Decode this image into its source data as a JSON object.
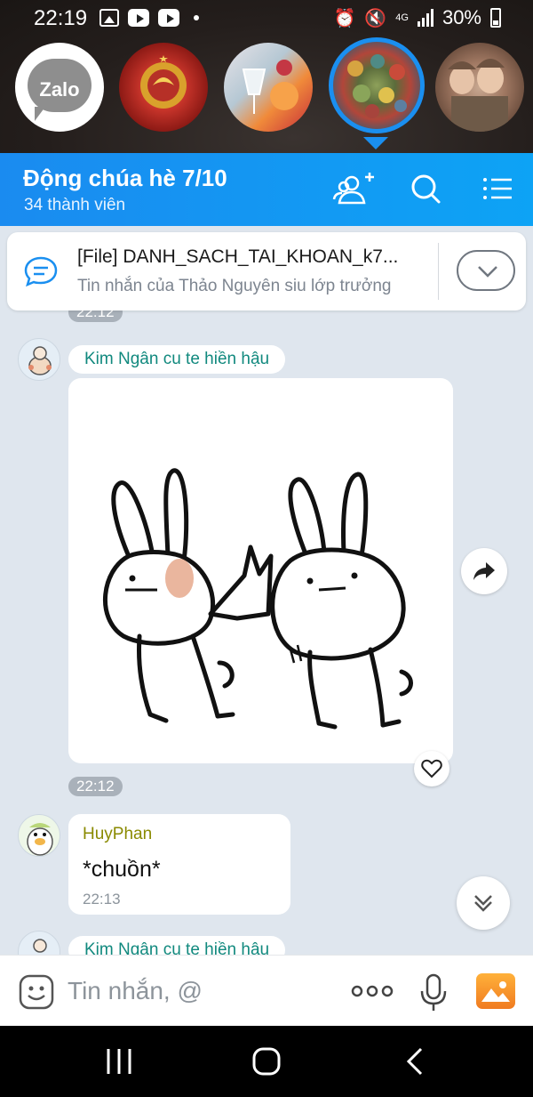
{
  "status_bar": {
    "time": "22:19",
    "network": "4G",
    "battery": "30%"
  },
  "stories": [
    {
      "name": "zalo-logo",
      "label": "Zalo"
    },
    {
      "name": "soviet-emblem"
    },
    {
      "name": "drinks"
    },
    {
      "name": "colorful-crowd",
      "active": true
    },
    {
      "name": "cartoon-group"
    }
  ],
  "header": {
    "title": "Động chúa hè 7/10",
    "subtitle": "34 thành viên",
    "accent": "#1a8ff0"
  },
  "pinned": {
    "title": "[File] DANH_SACH_TAI_KHOAN_k7...",
    "subtitle": "Tin nhắn của Thảo Nguyên siu lớp trưởng"
  },
  "messages": {
    "prev_time": "22:12",
    "sticker_sender": "Kim Ngân cu te hiền hậu",
    "sticker_time": "22:12",
    "text_sender": "HuyPhan",
    "text_body": "*chuồn*",
    "text_time": "22:13",
    "next_sender": "Kim Ngân cu te hiền hậu"
  },
  "composer": {
    "placeholder": "Tin nhắn, @"
  },
  "icons": {
    "add_member": "add-user-icon",
    "search": "search-icon",
    "menu": "list-icon",
    "share": "share-icon",
    "heart": "heart-icon",
    "scroll_down": "chevrons-down-icon",
    "emoji": "emoji-icon",
    "more": "more-icon",
    "mic": "mic-icon",
    "gallery": "image-icon"
  }
}
